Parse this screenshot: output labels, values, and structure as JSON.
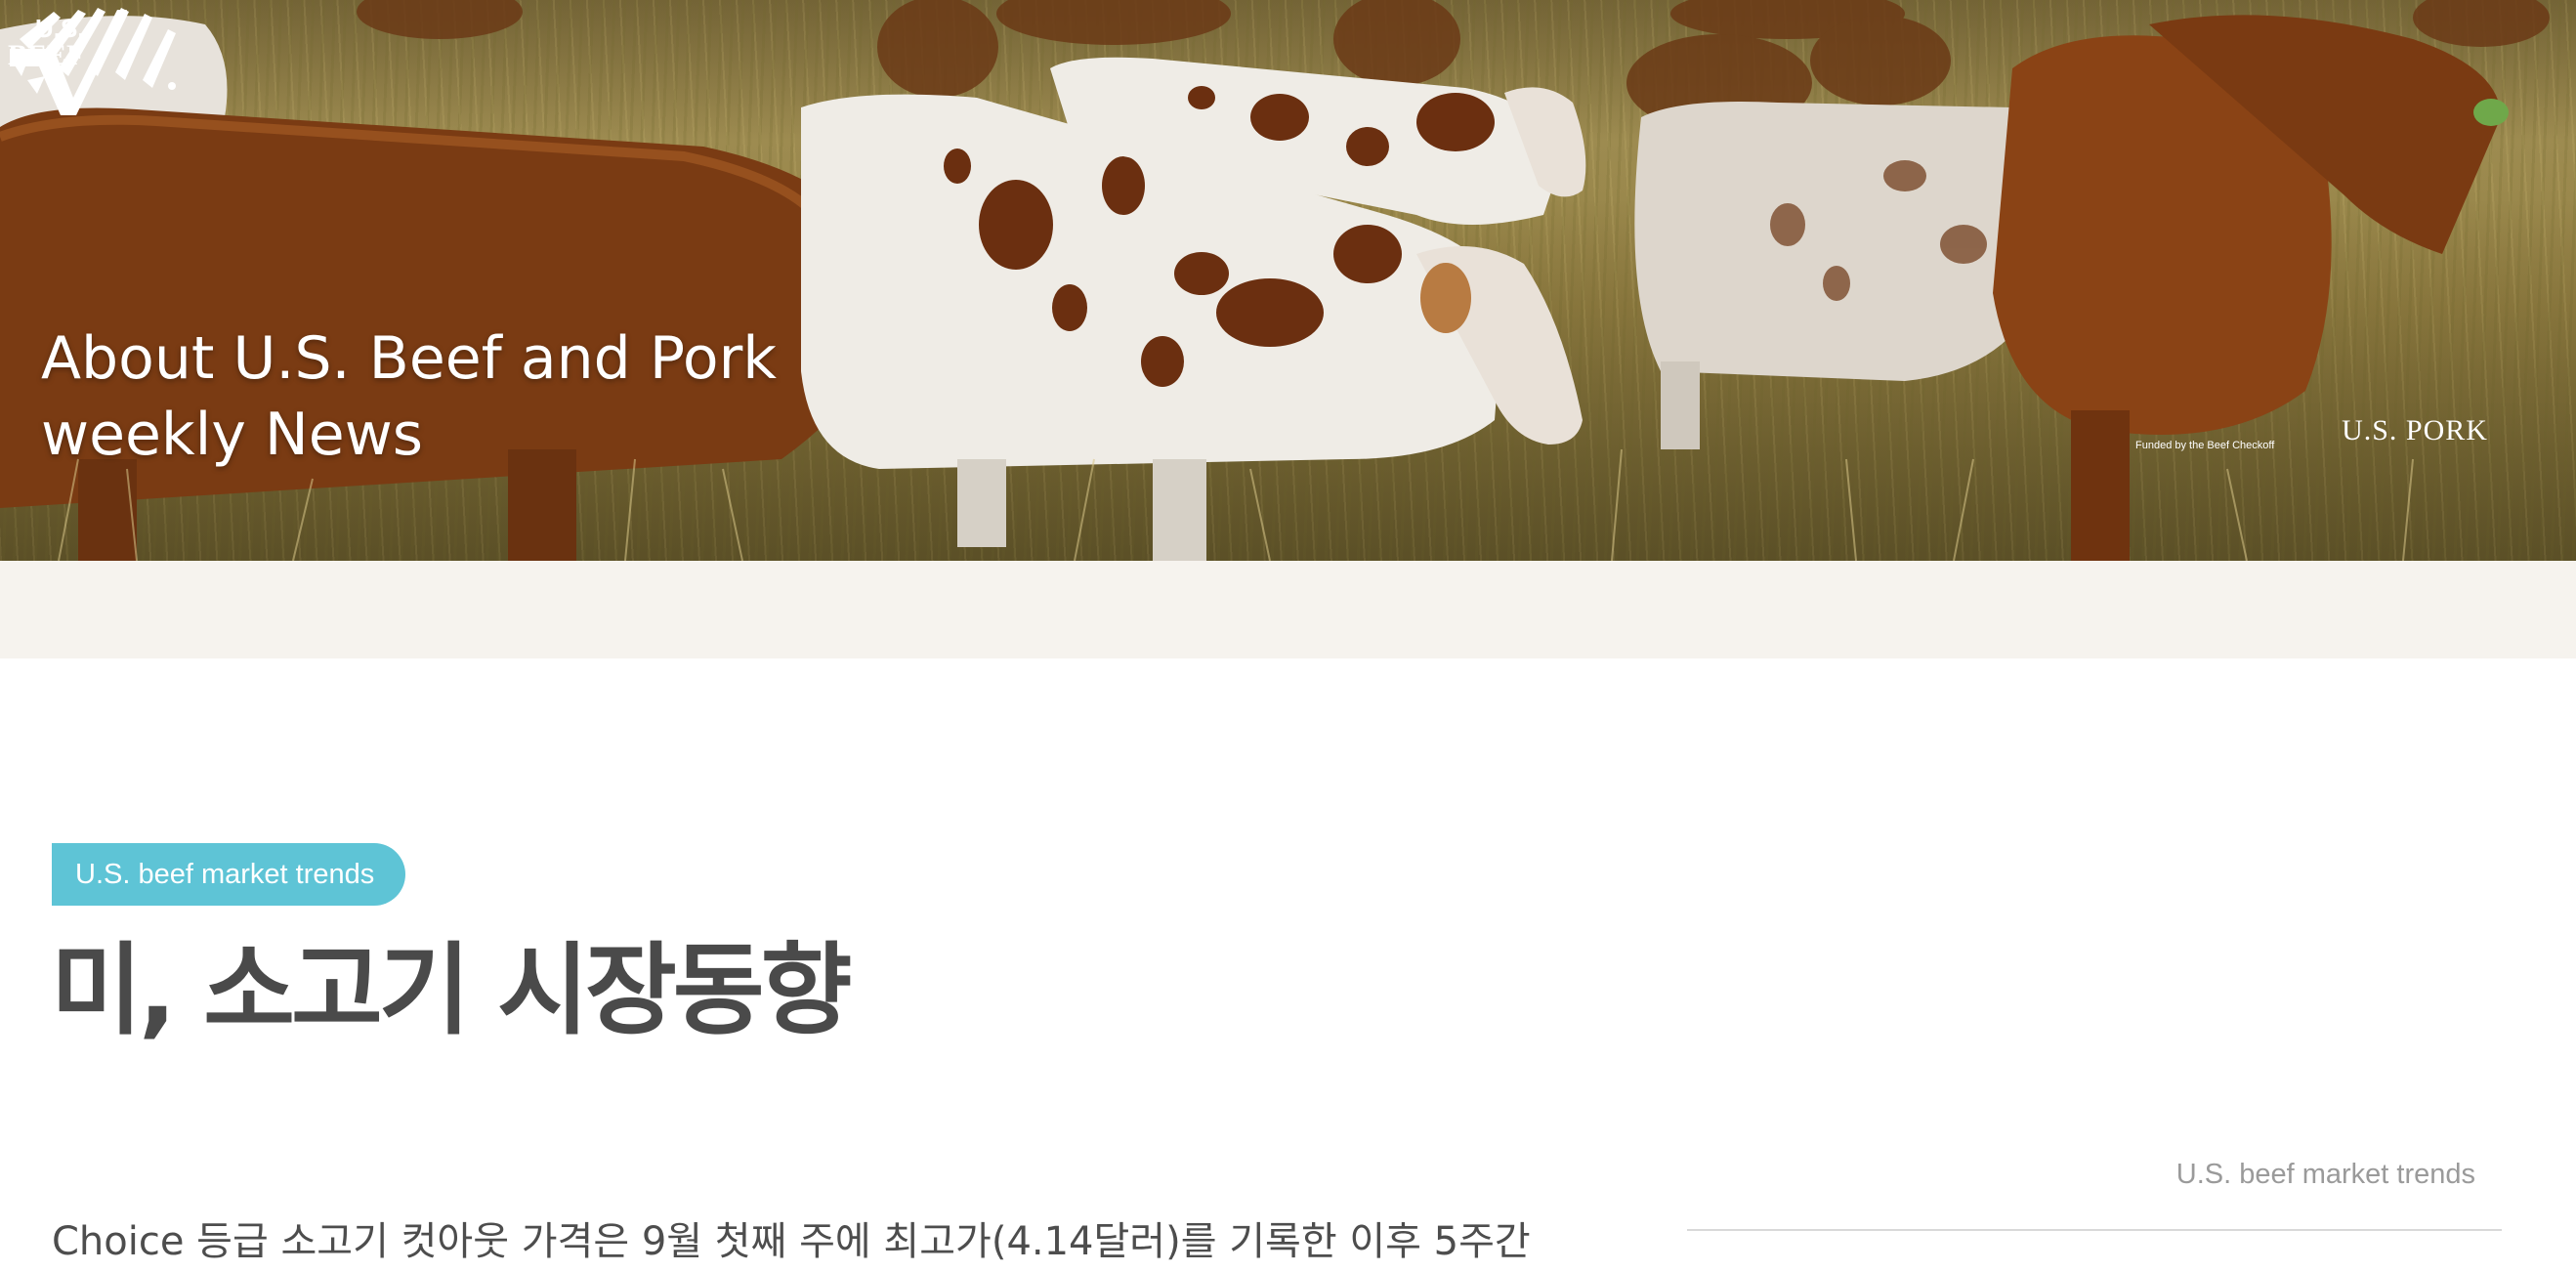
{
  "hero": {
    "title_line1": "About U.S. Beef and Pork",
    "title_line2": "weekly News",
    "beef_logo": {
      "text_top": "U.S.",
      "text_bottom": "BEEF",
      "caption": "Funded by the Beef Checkoff"
    },
    "pork_logo": {
      "text": "U.S. PORK"
    },
    "image_icon": "cattle-pasture-photo"
  },
  "article": {
    "tag": "U.S. beef market trends",
    "headline": "미, 소고기 시장동향",
    "body_first_line": "Choice 등급 소고기 컷아웃 가격은 9월 첫째 주에 최고가(4.14달러)를 기록한 이후 5주간"
  },
  "sidebar": {
    "label": "U.S. beef market trends"
  },
  "colors": {
    "tag_bg": "#5ec4d6",
    "band_bg": "#f6f3ee",
    "headline": "#4a4a4a"
  }
}
